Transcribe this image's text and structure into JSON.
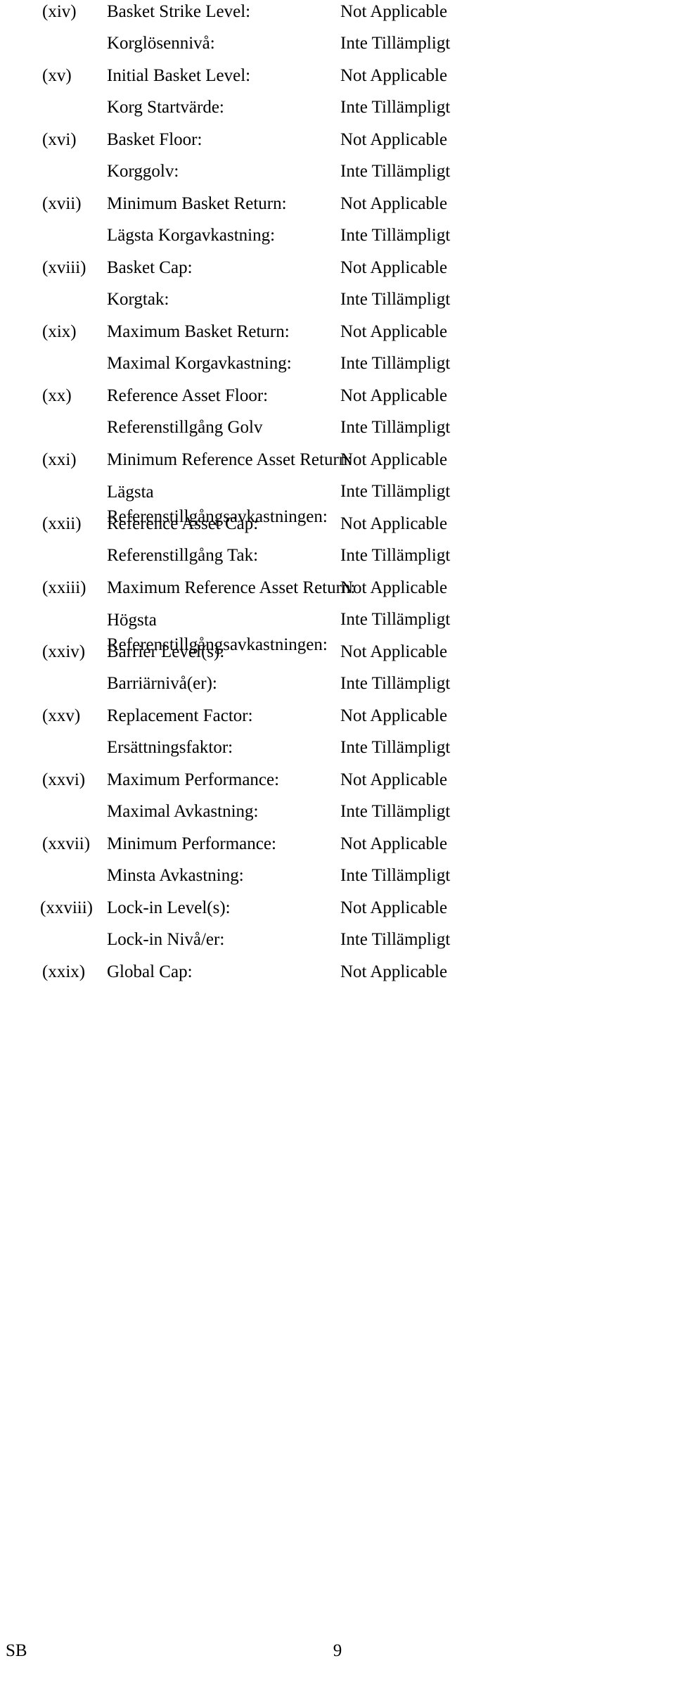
{
  "document": {
    "language_pair": [
      "English",
      "Swedish"
    ],
    "column_headers_visible": false
  },
  "terms": [
    {
      "number": "(xiv)",
      "en_label": "Basket Strike Level:",
      "en_value": "Not Applicable",
      "sv_label": "Korglösennivå:",
      "sv_value": "Inte Tillämpligt",
      "wrap": false
    },
    {
      "number": "(xv)",
      "en_label": "Initial Basket Level:",
      "en_value": "Not Applicable",
      "sv_label": "Korg Startvärde:",
      "sv_value": "Inte Tillämpligt",
      "wrap": false
    },
    {
      "number": "(xvi)",
      "en_label": "Basket Floor:",
      "en_value": "Not Applicable",
      "sv_label": "Korggolv:",
      "sv_value": "Inte Tillämpligt",
      "wrap": false
    },
    {
      "number": "(xvii)",
      "en_label": "Minimum Basket Return:",
      "en_value": "Not Applicable",
      "sv_label": "Lägsta Korgavkastning:",
      "sv_value": "Inte Tillämpligt",
      "wrap": false
    },
    {
      "number": "(xviii)",
      "en_label": "Basket Cap:",
      "en_value": "Not Applicable",
      "sv_label": "Korgtak:",
      "sv_value": "Inte Tillämpligt",
      "wrap": false
    },
    {
      "number": "(xix)",
      "en_label": "Maximum Basket Return:",
      "en_value": "Not Applicable",
      "sv_label": "Maximal Korgavkastning:",
      "sv_value": "Inte Tillämpligt",
      "wrap": false
    },
    {
      "number": "(xx)",
      "en_label": "Reference Asset Floor:",
      "en_value": "Not Applicable",
      "sv_label": "Referenstillgång Golv",
      "sv_value": "Inte Tillämpligt",
      "wrap": false
    },
    {
      "number": "(xxi)",
      "en_label": "Minimum Reference Asset Return:",
      "en_value": "Not Applicable",
      "sv_label": "Lägsta Referenstillgångsavkastningen:",
      "sv_value": "Inte Tillämpligt",
      "wrap": true
    },
    {
      "number": "(xxii)",
      "en_label": "Reference Asset Cap:",
      "en_value": "Not Applicable",
      "sv_label": "Referenstillgång Tak:",
      "sv_value": "Inte Tillämpligt",
      "wrap": false
    },
    {
      "number": "(xxiii)",
      "en_label": "Maximum Reference Asset Return:",
      "en_value": "Not Applicable",
      "sv_label": "Högsta Referenstillgångsavkastningen:",
      "sv_value": "Inte Tillämpligt",
      "wrap": true
    },
    {
      "number": "(xxiv)",
      "en_label": "Barrier Level(s):",
      "en_value": "Not Applicable",
      "sv_label": "Barriärnivå(er):",
      "sv_value": "Inte Tillämpligt",
      "wrap": false
    },
    {
      "number": "(xxv)",
      "en_label": "Replacement Factor:",
      "en_value": "Not Applicable",
      "sv_label": "Ersättningsfaktor:",
      "sv_value": "Inte Tillämpligt",
      "wrap": false
    },
    {
      "number": "(xxvi)",
      "en_label": "Maximum Performance:",
      "en_value": "Not Applicable",
      "sv_label": "Maximal Avkastning:",
      "sv_value": "Inte Tillämpligt",
      "wrap": false
    },
    {
      "number": "(xxvii)",
      "en_label": "Minimum Performance:",
      "en_value": "Not Applicable",
      "sv_label": "Minsta Avkastning:",
      "sv_value": "Inte Tillämpligt",
      "wrap": false
    },
    {
      "number": "(xxviii)",
      "en_label": "Lock-in Level(s):",
      "en_value": "Not Applicable",
      "sv_label": "Lock-in Nivå/er:",
      "sv_value": "Inte Tillämpligt",
      "wrap": false
    },
    {
      "number": "(xxix)",
      "en_label": "Global Cap:",
      "en_value": "Not Applicable",
      "sv_label": "",
      "sv_value": "",
      "wrap": false
    }
  ],
  "footer": {
    "left_mark": "SB",
    "page_number": "9"
  }
}
